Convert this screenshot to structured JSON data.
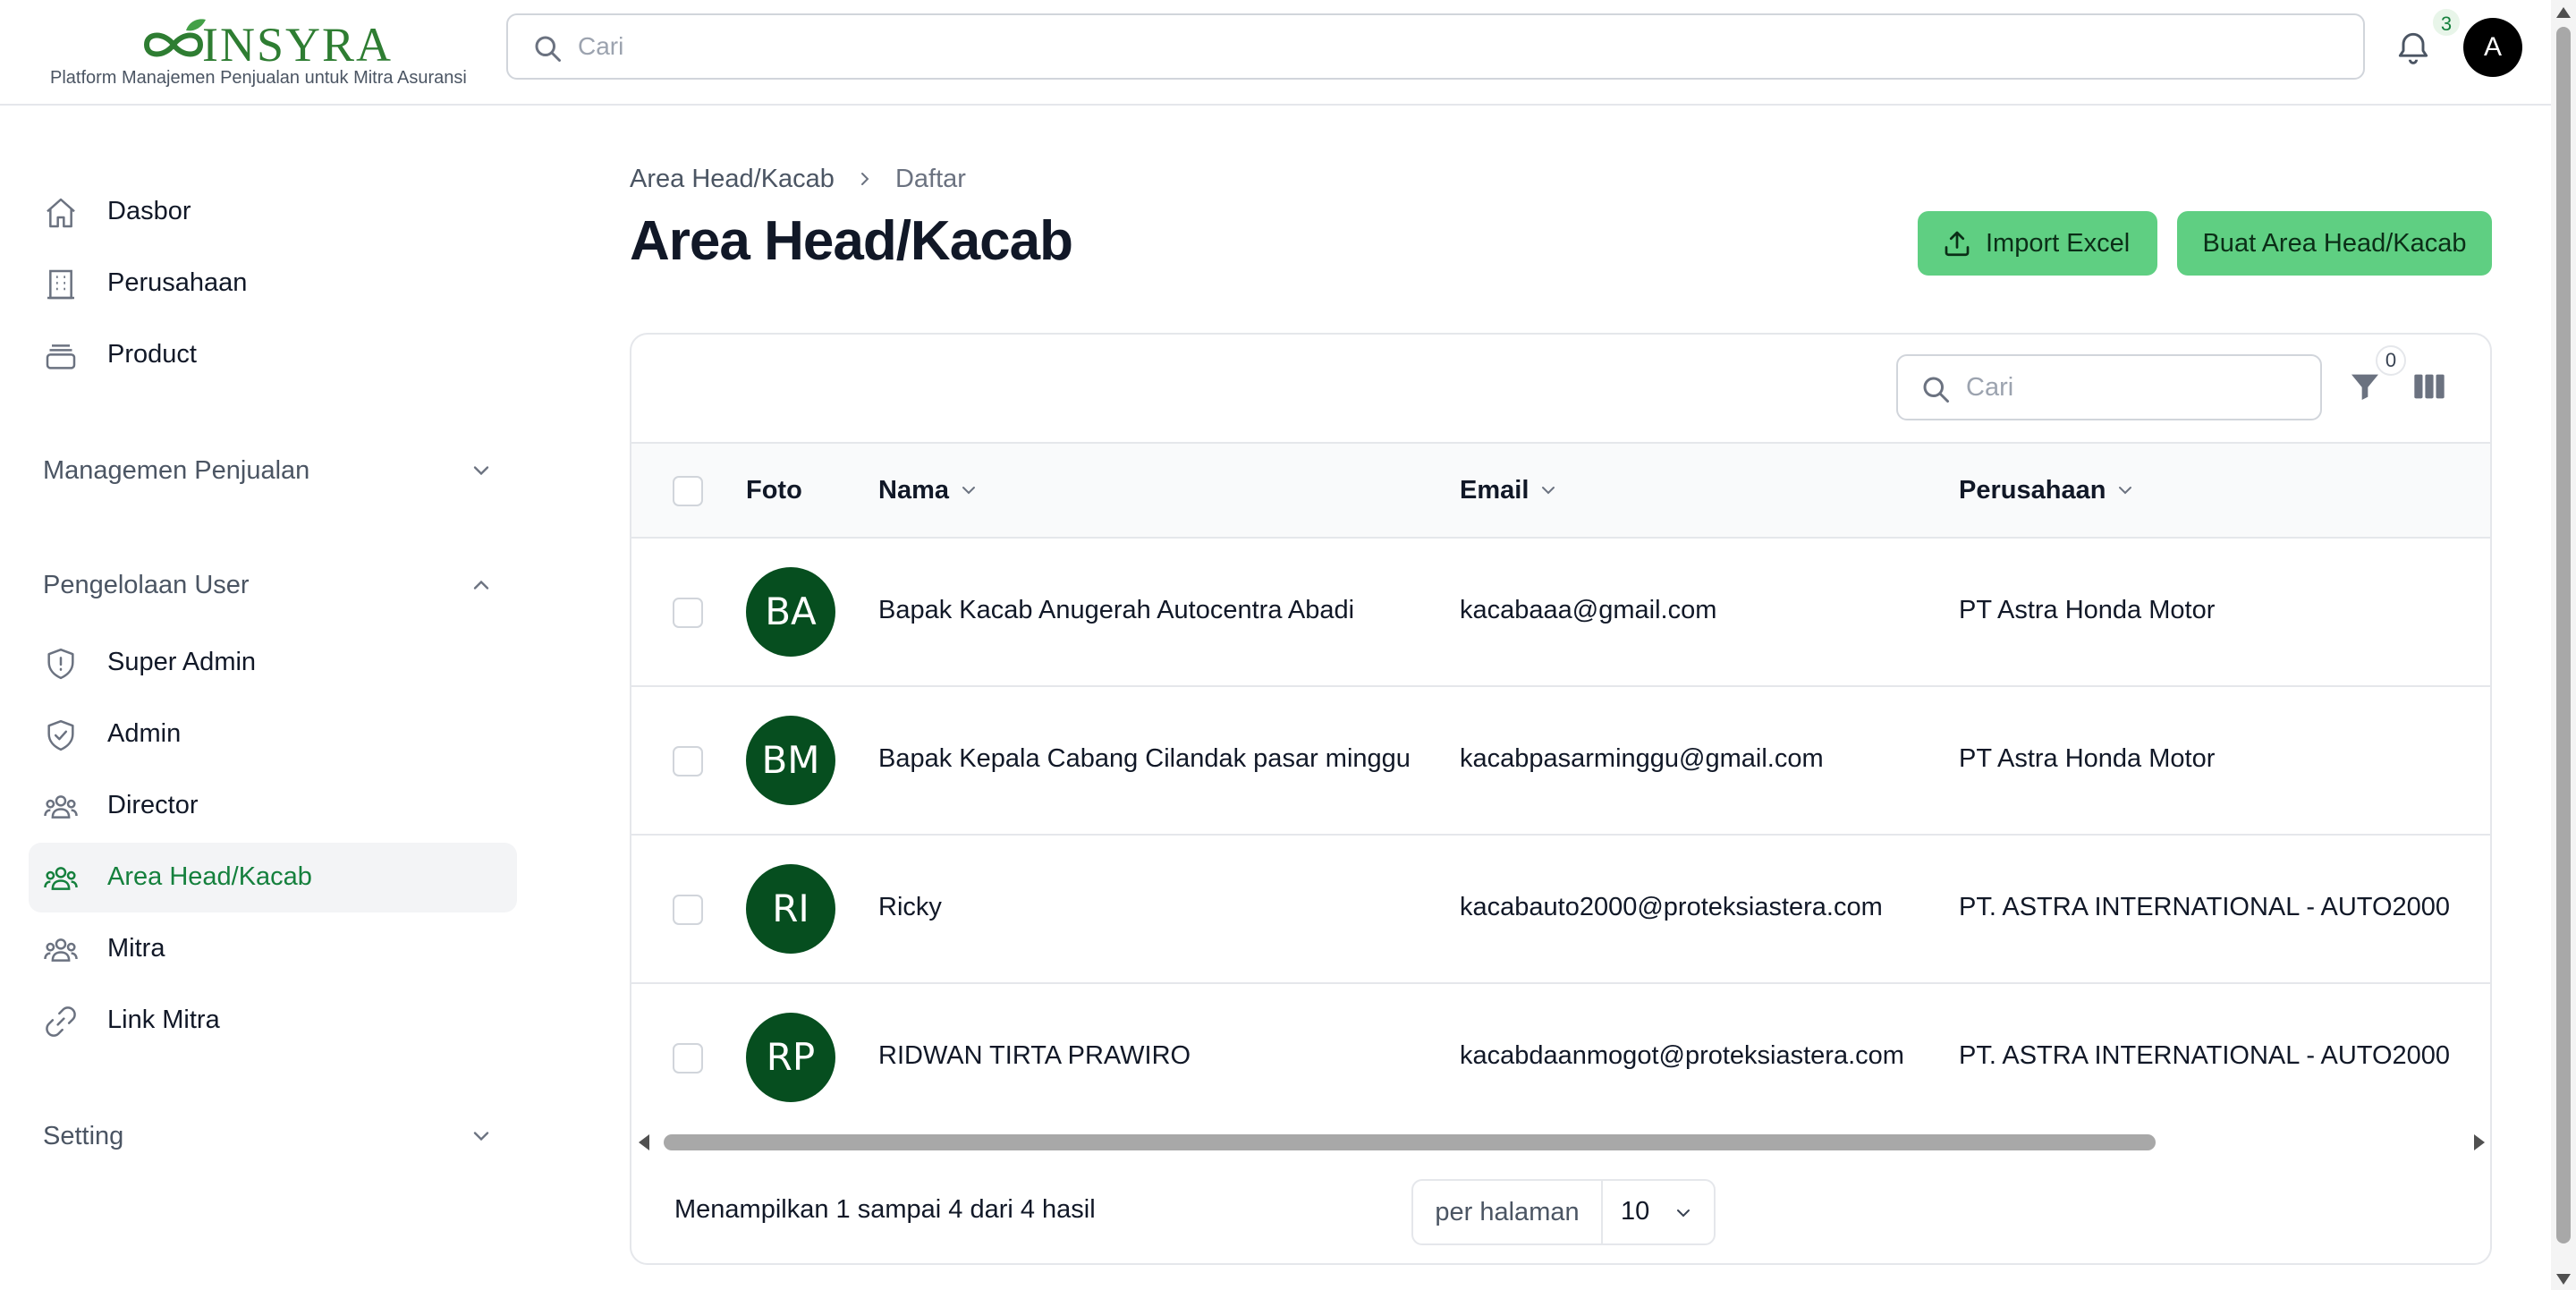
{
  "app": {
    "brand": "INSYRA",
    "tagline": "Platform Manajemen Penjualan untuk Mitra Asuransi"
  },
  "topbar": {
    "search_placeholder": "Cari",
    "notification_count": "3",
    "user_initial": "A"
  },
  "sidebar": {
    "items": [
      {
        "label": "Dasbor",
        "icon": "home-icon"
      },
      {
        "label": "Perusahaan",
        "icon": "building-icon"
      },
      {
        "label": "Product",
        "icon": "archive-box-icon"
      }
    ],
    "groups": {
      "sales": {
        "label": "Managemen Penjualan",
        "expanded": false
      },
      "users": {
        "label": "Pengelolaan User",
        "expanded": true,
        "items": [
          {
            "label": "Super Admin",
            "icon": "shield-exclamation-icon"
          },
          {
            "label": "Admin",
            "icon": "shield-check-icon"
          },
          {
            "label": "Director",
            "icon": "user-group-icon"
          },
          {
            "label": "Area Head/Kacab",
            "icon": "user-group-icon",
            "active": true
          },
          {
            "label": "Mitra",
            "icon": "user-group-icon"
          },
          {
            "label": "Link Mitra",
            "icon": "link-icon"
          }
        ]
      },
      "setting": {
        "label": "Setting",
        "expanded": false
      }
    }
  },
  "page": {
    "breadcrumb": [
      "Area Head/Kacab",
      "Daftar"
    ],
    "title": "Area Head/Kacab",
    "import_label": "Import Excel",
    "create_label": "Buat Area Head/Kacab"
  },
  "table": {
    "search_placeholder": "Cari",
    "filter_count": "0",
    "columns": {
      "foto": "Foto",
      "nama": "Nama",
      "email": "Email",
      "perusahaan": "Perusahaan"
    },
    "rows": [
      {
        "initials": "BA",
        "nama": "Bapak Kacab Anugerah Autocentra Abadi",
        "email": "kacabaaa@gmail.com",
        "perusahaan": "PT Astra Honda Motor"
      },
      {
        "initials": "BM",
        "nama": "Bapak Kepala Cabang Cilandak pasar minggu",
        "email": "kacabpasarminggu@gmail.com",
        "perusahaan": "PT Astra Honda Motor"
      },
      {
        "initials": "RI",
        "nama": "Ricky",
        "email": "kacabauto2000@proteksiastera.com",
        "perusahaan": "PT. ASTRA INTERNATIONAL - AUTO2000"
      },
      {
        "initials": "RP",
        "nama": "RIDWAN TIRTA PRAWIRO",
        "email": "kacabdaanmogot@proteksiastera.com",
        "perusahaan": "PT. ASTRA INTERNATIONAL - AUTO2000"
      }
    ],
    "footer_text": "Menampilkan 1 sampai 4 dari 4 hasil",
    "per_page_label": "per halaman",
    "per_page_value": "10"
  },
  "colors": {
    "brand_green": "#2e7d32",
    "button_green": "#5fcf82",
    "avatar_green": "#064e1f",
    "active_nav_text": "#15803d"
  }
}
